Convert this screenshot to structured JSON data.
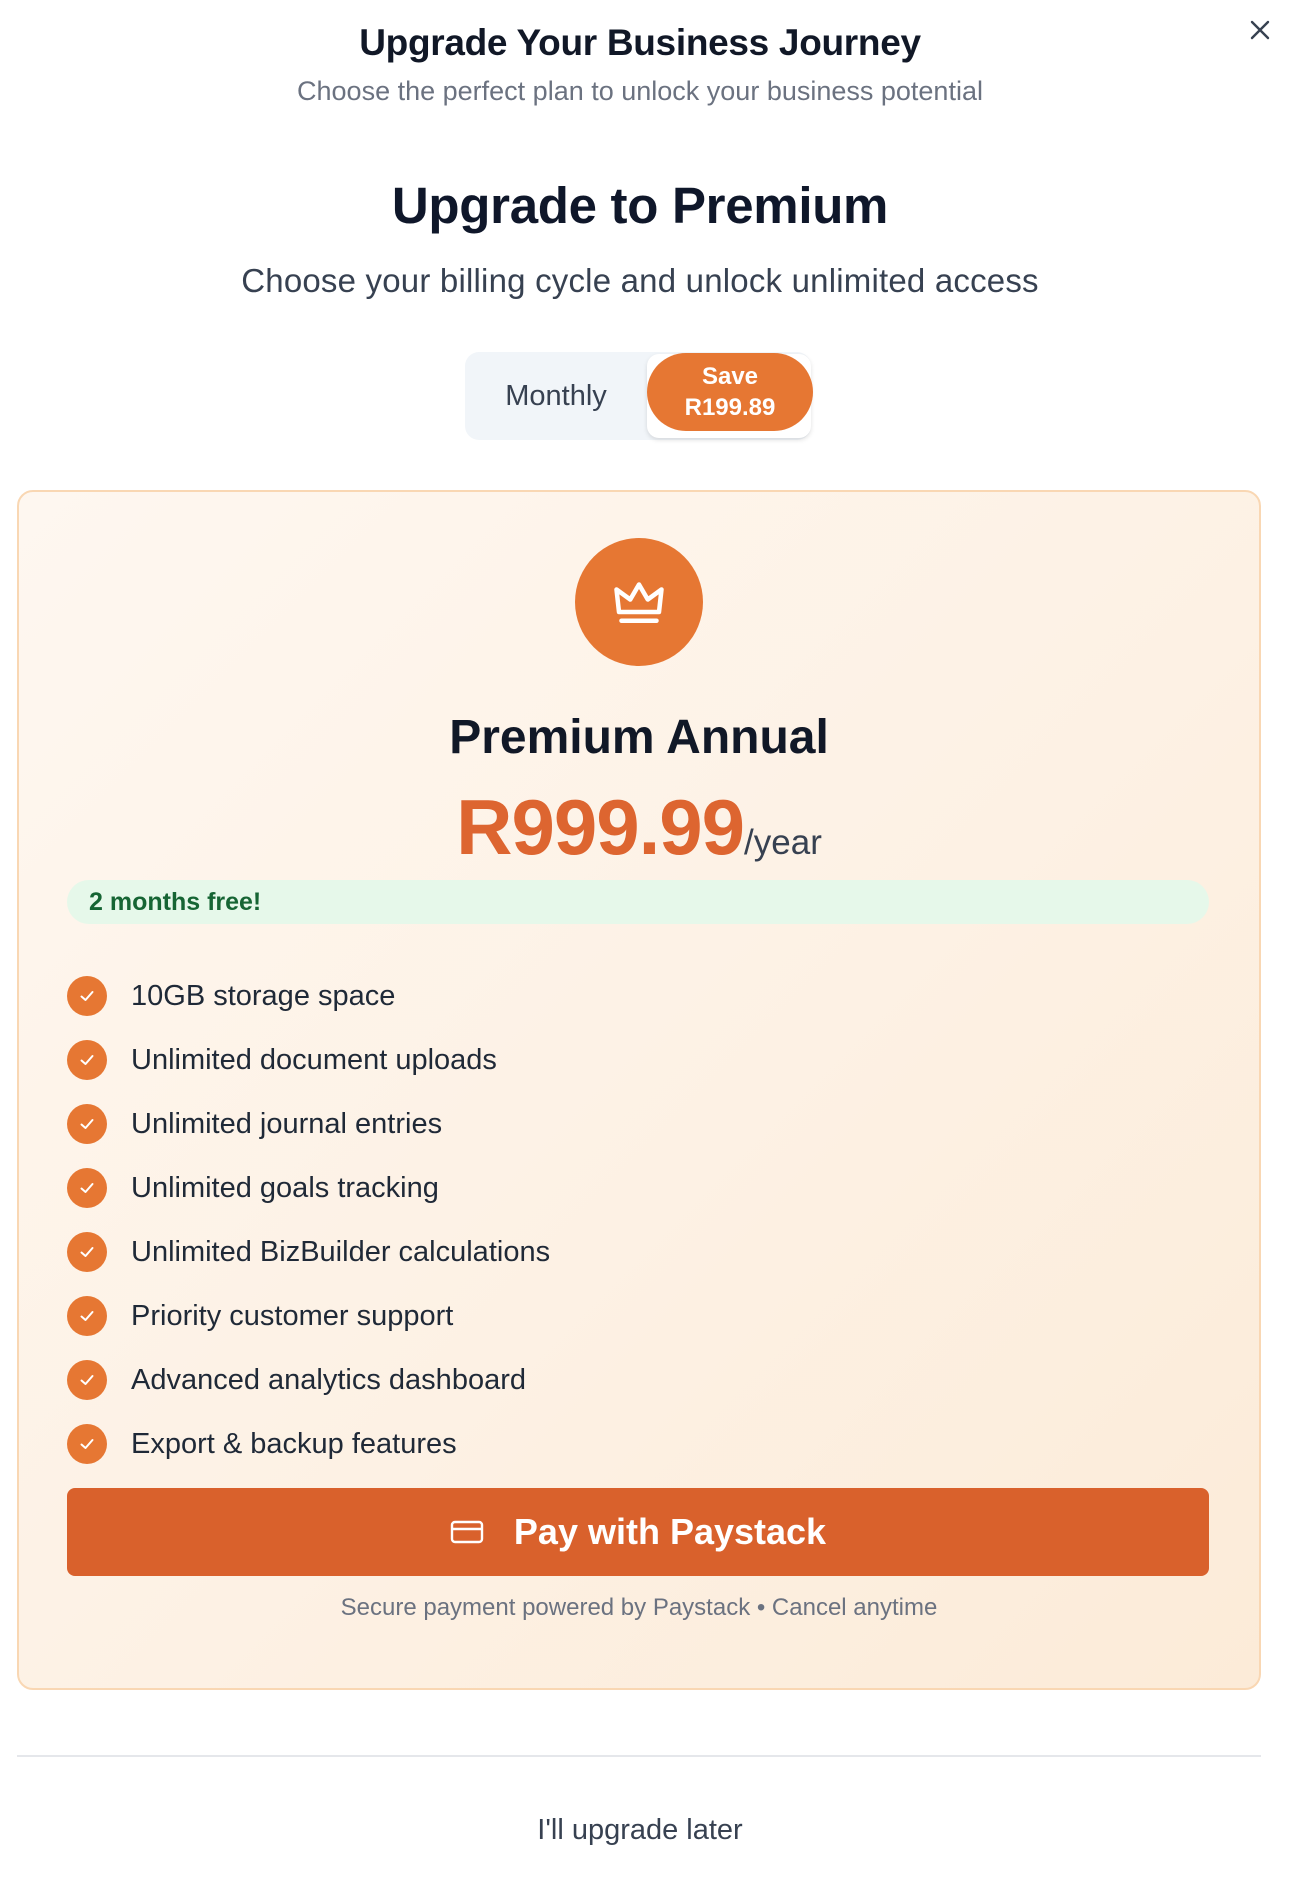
{
  "modal": {
    "title": "Upgrade Your Business Journey",
    "subtitle": "Choose the perfect plan to unlock your business potential",
    "close_icon": "close-icon"
  },
  "section": {
    "title": "Upgrade to Premium",
    "subtitle": "Choose your billing cycle and unlock unlimited access"
  },
  "billing_toggle": {
    "monthly_label": "Monthly",
    "save_label": "Save",
    "save_amount": "R199.89",
    "selected": "annual"
  },
  "plan": {
    "icon": "crown-icon",
    "name": "Premium Annual",
    "price": "R999.99",
    "period": "/year",
    "badge": "2 months free!",
    "features": [
      "10GB storage space",
      "Unlimited document uploads",
      "Unlimited journal entries",
      "Unlimited goals tracking",
      "Unlimited BizBuilder calculations",
      "Priority customer support",
      "Advanced analytics dashboard",
      "Export & backup features"
    ],
    "pay_button": "Pay with Paystack",
    "secure_note": "Secure payment powered by Paystack • Cancel anytime"
  },
  "footer": {
    "later_button": "I'll upgrade later"
  },
  "colors": {
    "accent": "#e67733",
    "price": "#dd6530",
    "pay_button": "#d9612c",
    "badge_bg": "#e6f8ea",
    "badge_text": "#166534"
  }
}
